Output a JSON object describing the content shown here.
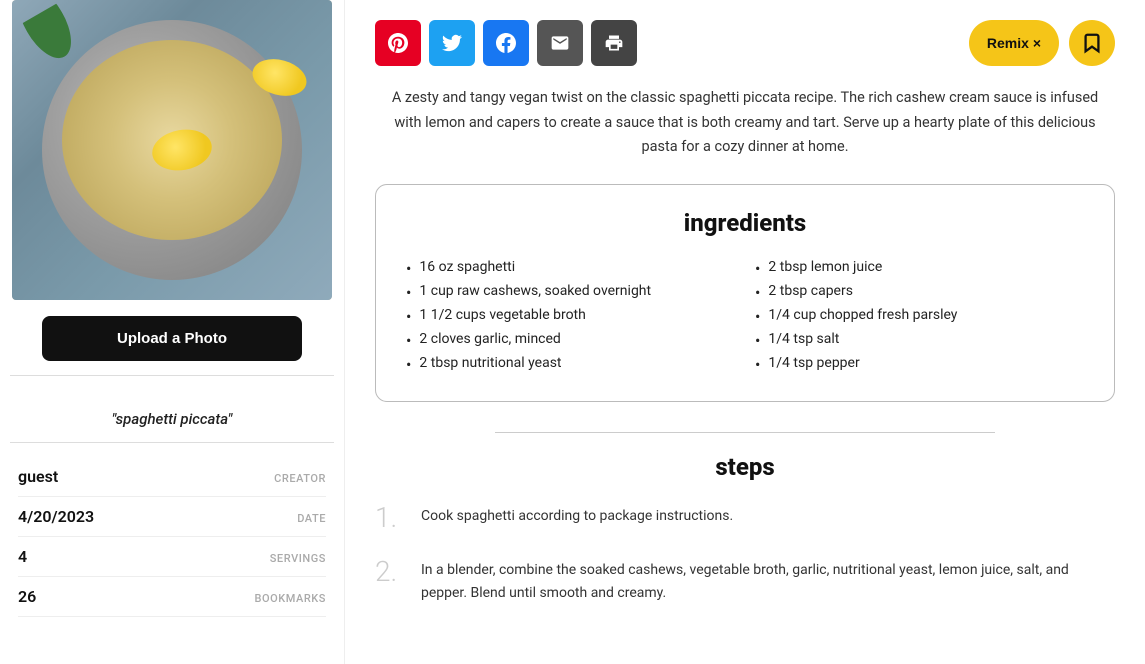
{
  "sidebar": {
    "upload_button": "Upload a Photo",
    "recipe_title": "\"spaghetti piccata\"",
    "meta": [
      {
        "id": "creator",
        "value": "guest",
        "label": "CREATOR"
      },
      {
        "id": "date",
        "value": "4/20/2023",
        "label": "DATE"
      },
      {
        "id": "servings",
        "value": "4",
        "label": "SERVINGS"
      },
      {
        "id": "bookmarks",
        "value": "26",
        "label": "BOOKMARKS"
      }
    ]
  },
  "share": {
    "icons": [
      {
        "id": "pinterest",
        "symbol": "P",
        "label": "pinterest-button"
      },
      {
        "id": "twitter",
        "symbol": "t",
        "label": "twitter-button"
      },
      {
        "id": "facebook",
        "symbol": "f",
        "label": "facebook-button"
      },
      {
        "id": "email",
        "symbol": "✉",
        "label": "email-button"
      },
      {
        "id": "print",
        "symbol": "⊟",
        "label": "print-button"
      }
    ],
    "remix_label": "Remix ×",
    "bookmark_symbol": "🔖"
  },
  "description": "A zesty and tangy vegan twist on the classic spaghetti piccata recipe. The rich cashew cream sauce is infused with lemon and capers to create a sauce that is both creamy and tart. Serve up a hearty plate of this delicious pasta for a cozy dinner at home.",
  "ingredients": {
    "heading": "ingredients",
    "left_column": [
      "16 oz spaghetti",
      "1 cup raw cashews, soaked overnight",
      "1 1/2 cups vegetable broth",
      "2 cloves garlic, minced",
      "2 tbsp nutritional yeast"
    ],
    "right_column": [
      "2 tbsp lemon juice",
      "2 tbsp capers",
      "1/4 cup chopped fresh parsley",
      "1/4 tsp salt",
      "1/4 tsp pepper"
    ]
  },
  "steps": {
    "heading": "steps",
    "items": [
      {
        "number": "1.",
        "text": "Cook spaghetti according to package instructions."
      },
      {
        "number": "2.",
        "text": "In a blender, combine the soaked cashews, vegetable broth, garlic, nutritional yeast, lemon juice, salt, and pepper. Blend until smooth and creamy."
      }
    ]
  }
}
